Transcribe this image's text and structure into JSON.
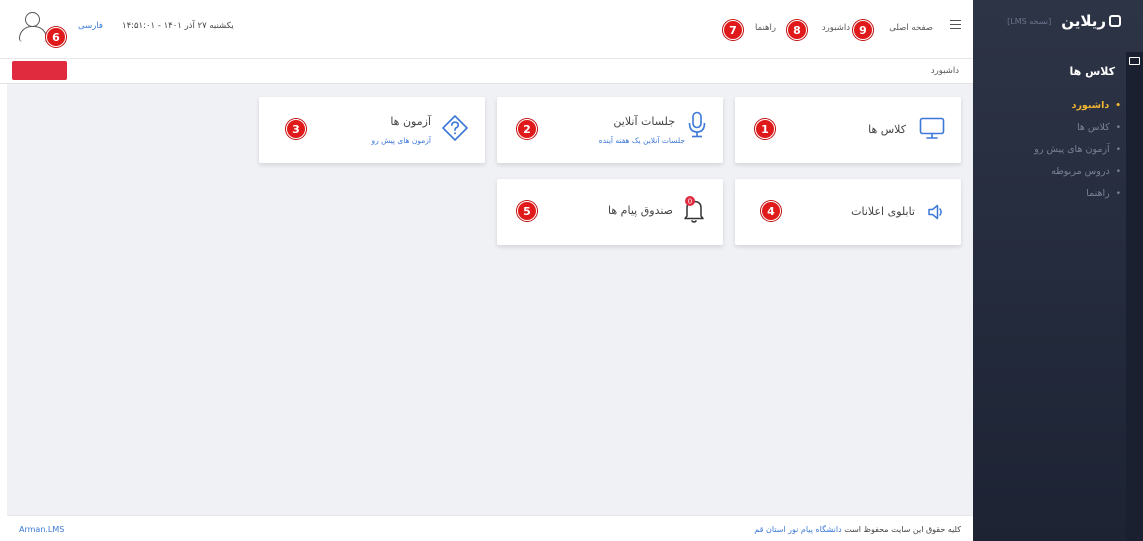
{
  "sidebar": {
    "logo_text": "ریلاین",
    "version": "[نسخه LMS]",
    "section_title": "کلاس ها",
    "items": [
      {
        "label": "داشبورد",
        "active": true
      },
      {
        "label": "کلاس ها",
        "active": false
      },
      {
        "label": "آزمون های پیش رو",
        "active": false
      },
      {
        "label": "دروس مربوطه",
        "active": false
      },
      {
        "label": "راهنما",
        "active": false
      }
    ]
  },
  "header": {
    "nav_home": "صفحه اصلی",
    "nav_dashboard": "داشبورد",
    "nav_help": "راهنما",
    "datetime": "یکشنبه ۲۷ آذر ۱۴۰۱ - ۱۴:۵۱:۰۱",
    "language": "فارسی",
    "badges": {
      "home": "9",
      "dashboard": "8",
      "help": "7",
      "avatar": "6"
    }
  },
  "breadcrumb": "داشبورد",
  "cards": [
    {
      "title": "کلاس ها",
      "subtitle": "",
      "badge": "1",
      "icon": "monitor-icon"
    },
    {
      "title": "جلسات آنلاین",
      "subtitle": "جلسات آنلاین یک هفته آینده",
      "badge": "2",
      "icon": "microphone-icon"
    },
    {
      "title": "آزمون ها",
      "subtitle": "آزمون های پیش رو",
      "badge": "3",
      "icon": "question-diamond-icon"
    },
    {
      "title": "تابلوی اعلانات",
      "subtitle": "",
      "badge": "4",
      "icon": "speaker-icon"
    },
    {
      "title": "صندوق پیام ها",
      "subtitle": "",
      "badge": "5",
      "icon": "bell-icon",
      "notification_count": "0"
    }
  ],
  "footer": {
    "brand": "Arman.LMS",
    "copyright": "کلیه حقوق این سایت محفوظ است",
    "org_link": "دانشگاه پیام نور استان قم"
  },
  "colors": {
    "sidebar_bg": "#2d3446",
    "active": "#f2b632",
    "accent": "#3c78d8",
    "badge": "#e01a1a",
    "block": "#e02b3f"
  }
}
